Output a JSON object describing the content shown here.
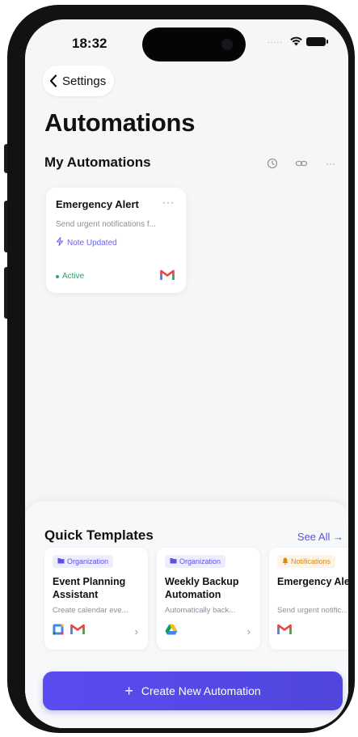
{
  "status_bar": {
    "time": "18:32",
    "signal": "....."
  },
  "nav": {
    "back_label": "Settings"
  },
  "page": {
    "title": "Automations"
  },
  "my_automations": {
    "title": "My Automations",
    "actions": [
      "history-icon",
      "link-icon",
      "more-icon"
    ],
    "more_label": "···",
    "items": [
      {
        "name": "Emergency Alert",
        "more": "···",
        "description": "Send urgent notifications f...",
        "trigger": "Note Updated",
        "status": "Active",
        "service_icons": [
          "gmail-icon"
        ]
      }
    ]
  },
  "quick_templates": {
    "title": "Quick Templates",
    "see_all": "See All →",
    "items": [
      {
        "tag": "Organization",
        "tag_icon": "folder-icon",
        "name": "Event Planning Assistant",
        "description": "Create calendar eve...",
        "service_icons": [
          "google-calendar-icon",
          "gmail-icon"
        ],
        "chevron": "›"
      },
      {
        "tag": "Organization",
        "tag_icon": "folder-icon",
        "name": "Weekly Backup Automation",
        "description": "Automatically back...",
        "service_icons": [
          "google-drive-icon"
        ],
        "chevron": "›"
      },
      {
        "tag": "Notifications",
        "tag_icon": "bell-icon",
        "name": "Emergency Alert",
        "description": "Send urgent notific...",
        "service_icons": [
          "gmail-icon"
        ],
        "chevron": "›"
      }
    ]
  },
  "create_button": {
    "icon": "+",
    "label": "Create New Automation"
  },
  "colors": {
    "accent": "#5b52e0",
    "active": "#1fa86a",
    "notification_tag": "#e08a10",
    "background": "#f4f6f8"
  }
}
